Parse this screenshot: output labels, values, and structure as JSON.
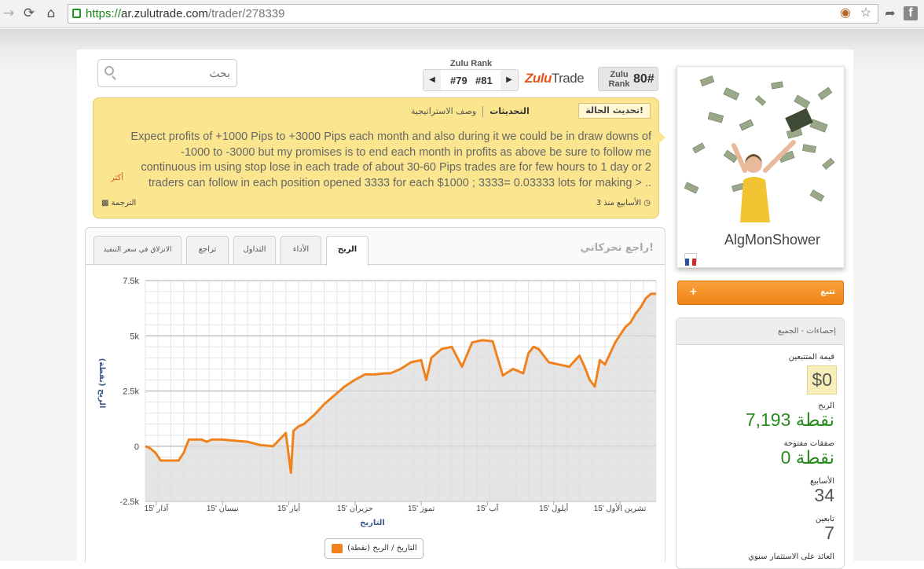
{
  "browser": {
    "url_scheme": "https://",
    "url_host": "ar.zulutrade.com",
    "url_path": "/trader/278339"
  },
  "header": {
    "search_placeholder": "بحث",
    "zulu_rank_label": "Zulu Rank",
    "rank_prev": "#79",
    "rank_next": "#81",
    "logo_zulu": "Zulu",
    "logo_trade": "Trade",
    "rank_badge_label": "Zulu Rank",
    "rank_badge_value": "80#"
  },
  "status": {
    "tab_label": "تحديث الحالة!",
    "nav_updates": "التحديثات",
    "nav_strategy": "وصف الاستراتيجية",
    "line1": "Expect profits of +1000 Pips to +3000 Pips each month and also during it we could be in draw downs of",
    "line2": "-1000 to -3000 but my promises is to end each month in profits as above be sure to follow me",
    "line3": "continuous im using stop lose in each trade of about 30-60 Pips trades are for few hours to 1 day or 2",
    "line4": "traders can follow in each position opened 3333 for each $1000 ; 3333= 0.03333 lots for making > ..",
    "more": "أكثر",
    "time": "3 الأسابيع منذ",
    "translate": "الترجمة"
  },
  "chart_panel": {
    "title": "راجع تحركاتي!",
    "tabs": [
      "الربح",
      "الأداء",
      "التداول",
      "تراجع",
      "الانزلاق في سعر التنفيذ"
    ],
    "legend": "التاريخ / الربح (نقطة)"
  },
  "chart_data": {
    "type": "area",
    "xlabel": "التاريخ",
    "ylabel": "الربح (نقطة)",
    "ylim": [
      -2500,
      7500
    ],
    "yticks": [
      "7.5k",
      "5k",
      "2.5k",
      "0",
      "-2.5k"
    ],
    "xticks": [
      "آذار '15",
      "نيسان '15",
      "أيار '15",
      "حزيران '15",
      "تموز '15",
      "آب '15",
      "أيلول '15",
      "تشرين الأول '15"
    ],
    "series_color": "#f0821e",
    "x": [
      0,
      2,
      4,
      6,
      8,
      10,
      13,
      15,
      17,
      18,
      20,
      22,
      24,
      26,
      30,
      35,
      40,
      45,
      50,
      55,
      57,
      58,
      59,
      60,
      62,
      66,
      70,
      74,
      78,
      82,
      86,
      90,
      94,
      96,
      100,
      104,
      108,
      110,
      112,
      116,
      120,
      124,
      128,
      132,
      136,
      140,
      144,
      148,
      150,
      152,
      154,
      158,
      162,
      166,
      170,
      172,
      174,
      176,
      178,
      180,
      184,
      188,
      190,
      192,
      194,
      196,
      198,
      200
    ],
    "y": [
      0,
      -100,
      -300,
      -650,
      -650,
      -650,
      -650,
      -300,
      300,
      300,
      300,
      300,
      200,
      300,
      300,
      250,
      200,
      50,
      0,
      600,
      -1200,
      700,
      800,
      900,
      1000,
      1400,
      1900,
      2300,
      2700,
      3000,
      3250,
      3250,
      3300,
      3300,
      3500,
      3800,
      3900,
      3000,
      4000,
      4400,
      4500,
      3600,
      4700,
      4800,
      4750,
      3200,
      3500,
      3300,
      4200,
      4500,
      4400,
      3800,
      3700,
      3600,
      4100,
      3600,
      3000,
      2700,
      3900,
      3700,
      4700,
      5400,
      5600,
      6000,
      6300,
      6700,
      6900,
      6900
    ]
  },
  "profile": {
    "name": "AlgMonShower",
    "follow_label": "تتبع",
    "follow_plus": "+"
  },
  "stats": {
    "header": "إحصاءات - الجميع",
    "followers_label": "قيمة المتتبعين",
    "followers_value": "$0",
    "profit_label": "الربح",
    "profit_value": "7,193 نقطة",
    "open_label": "صفقات مفتوحة",
    "open_value": "0 نقطة",
    "weeks_label": "الأسابيع",
    "weeks_value": "34",
    "followers_count_label": "تابعين",
    "followers_count_value": "7",
    "roi_label": "العائد على الاستثمار سنوي"
  }
}
